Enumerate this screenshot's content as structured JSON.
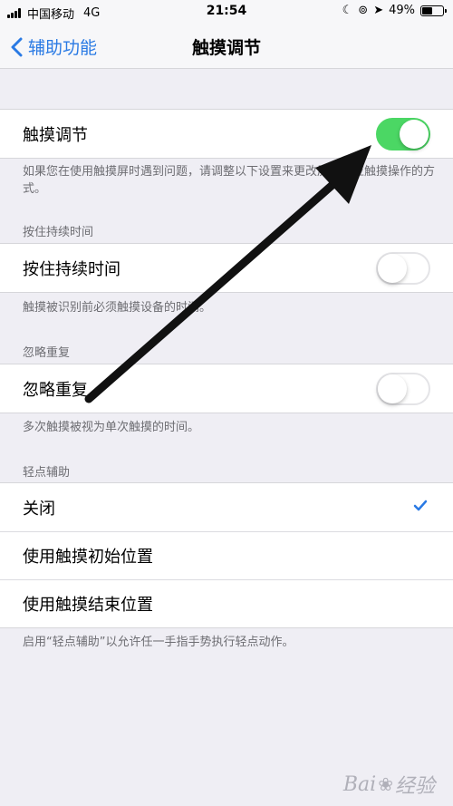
{
  "status_bar": {
    "carrier": "中国移动",
    "network": "4G",
    "time": "21:54",
    "battery_percent": "49%",
    "battery_level": 0.49
  },
  "nav": {
    "back_label": "辅助功能",
    "title": "触摸调节"
  },
  "touch_accommodations": {
    "label": "触摸调节",
    "on": true,
    "footer": "如果您在使用触摸屏时遇到问题，请调整以下设置来更改屏幕响应触摸操作的方式。"
  },
  "hold_duration": {
    "header": "按住持续时间",
    "label": "按住持续时间",
    "on": false,
    "footer": "触摸被识别前必须触摸设备的时间。"
  },
  "ignore_repeat": {
    "header": "忽略重复",
    "label": "忽略重复",
    "on": false,
    "footer": "多次触摸被视为单次触摸的时间。"
  },
  "tap_assistance": {
    "header": "轻点辅助",
    "options": [
      {
        "label": "关闭",
        "selected": true
      },
      {
        "label": "使用触摸初始位置",
        "selected": false
      },
      {
        "label": "使用触摸结束位置",
        "selected": false
      }
    ],
    "footer": "启用“轻点辅助”以允许任一手指手势执行轻点动作。"
  },
  "watermark": {
    "text_left": "Bai",
    "text_right": "经验"
  },
  "colors": {
    "accent": "#2a7ae4",
    "toggle_on": "#4bd764",
    "background": "#efeef4"
  }
}
